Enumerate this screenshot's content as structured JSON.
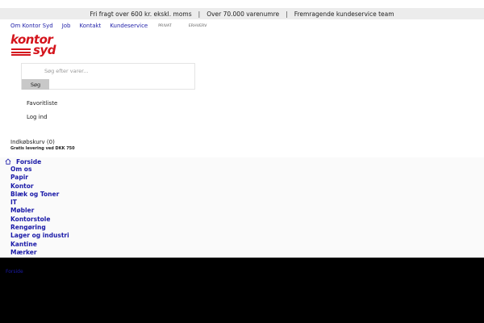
{
  "topbar": {
    "items": [
      "Fri fragt over 600 kr. ekskl. moms",
      "Over 70.000 varenumre",
      "Fremragende kundeservice team"
    ],
    "separator": "|"
  },
  "topnav": {
    "links": [
      "Om Kontor Syd",
      "Job",
      "Kontakt",
      "Kundeservice"
    ],
    "toggles": [
      "PRIVAT",
      "ERHVERV"
    ]
  },
  "logo": {
    "line1": "kontor",
    "line2": "syd"
  },
  "search": {
    "placeholder": "Søg efter varer...",
    "button_label": "Søg"
  },
  "account": {
    "favorites": "Favoritliste",
    "login": "Log ind"
  },
  "cart": {
    "label": "Indkøbskurv (0)",
    "shipping_note": "Gratis levering ved DKK 750"
  },
  "menu": {
    "home": "Forside",
    "items": [
      "Om os",
      "Papir",
      "Kontor",
      "Blæk og Toner",
      "IT",
      "Møbler",
      "Kontorstole",
      "Rengøring",
      "Lager og industri",
      "Kantine",
      "Mærker"
    ]
  },
  "footer": {
    "link": "Forside"
  },
  "colors": {
    "brand": "#d4141c",
    "link": "#1a1aa8",
    "topbar_bg": "#ececec"
  }
}
